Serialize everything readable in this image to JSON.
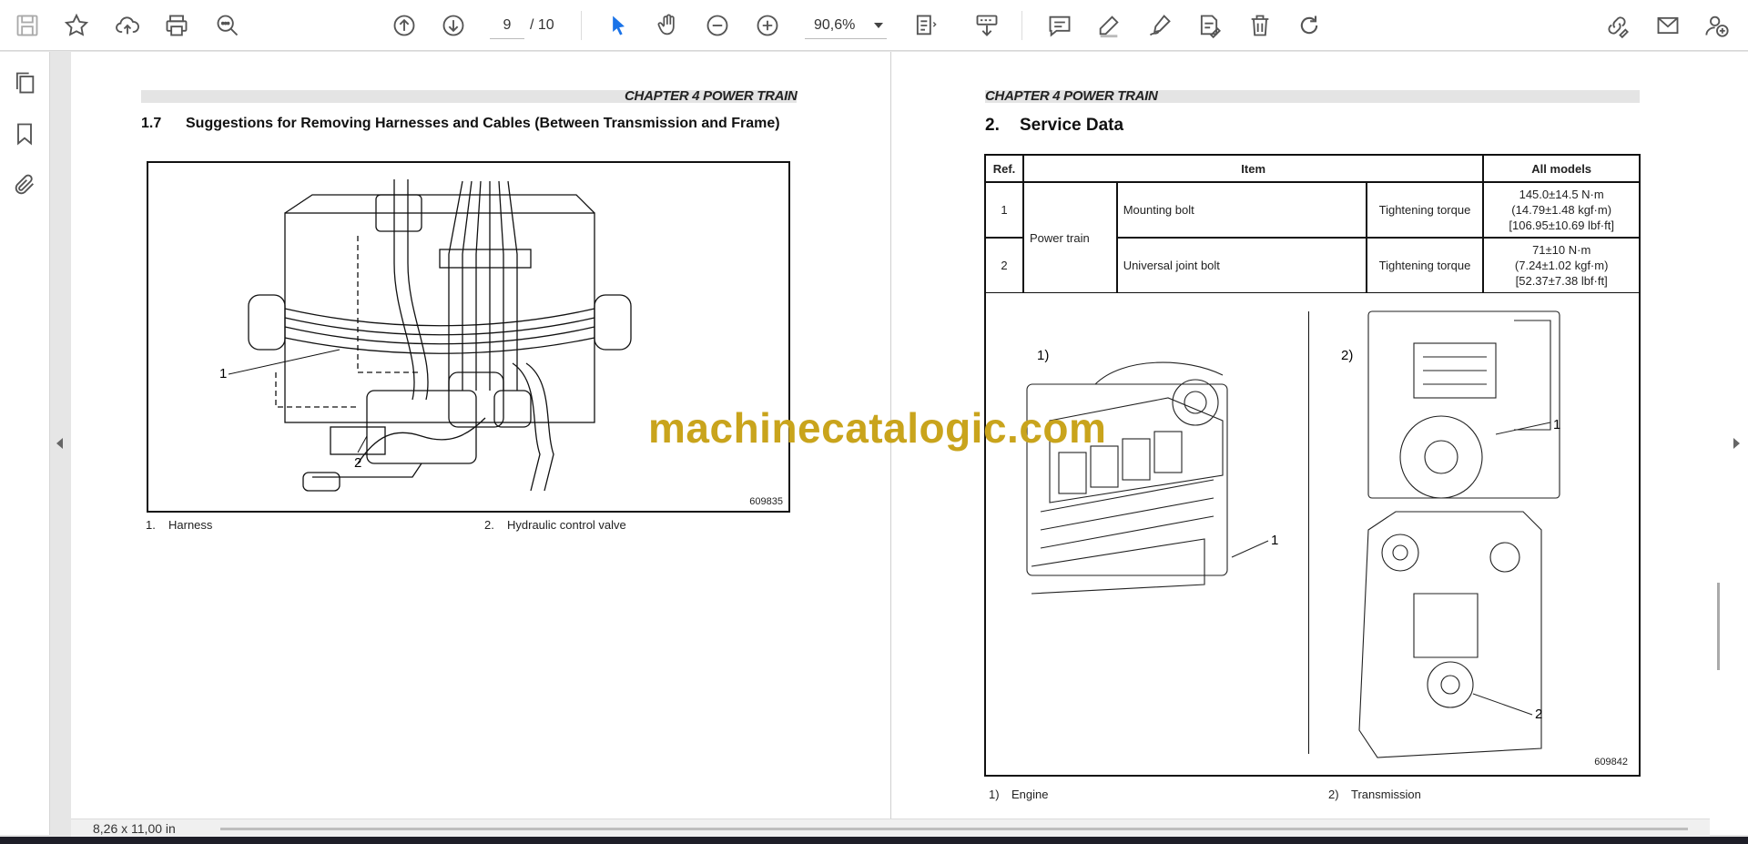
{
  "toolbar": {
    "page_current": "9",
    "page_total": "/ 10",
    "zoom": "90,6%"
  },
  "left_page": {
    "chapter": "CHAPTER 4 POWER TRAIN",
    "section_number": "1.7",
    "section_title": "Suggestions for Removing Harnesses and Cables (Between Transmission and Frame)",
    "figure_code": "609835",
    "callout_1": "1",
    "callout_2": "2",
    "legend": [
      {
        "num": "1.",
        "text": "Harness"
      },
      {
        "num": "2.",
        "text": "Hydraulic control valve"
      }
    ]
  },
  "right_page": {
    "chapter": "CHAPTER 4 POWER TRAIN",
    "section_number": "2.",
    "section_title": "Service Data",
    "table": {
      "headers": [
        "Ref.",
        "Item",
        "All models"
      ],
      "group": "Power train",
      "rows": [
        {
          "ref": "1",
          "item": "Mounting bolt",
          "type": "Tightening torque",
          "val1": "145.0±14.5 N·m",
          "val2": "(14.79±1.48 kgf·m)",
          "val3": "[106.95±10.69 lbf·ft]"
        },
        {
          "ref": "2",
          "item": "Universal joint bolt",
          "type": "Tightening torque",
          "val1": "71±10 N·m",
          "val2": "(7.24±1.02 kgf·m)",
          "val3": "[52.37±7.38 lbf·ft]"
        }
      ]
    },
    "figure_code": "609842",
    "panel1_label": "1)",
    "panel2_label": "2)",
    "engine_callout": "1",
    "trans_callout_1": "1",
    "trans_callout_2": "2",
    "legend": [
      {
        "num": "1)",
        "text": "Engine"
      },
      {
        "num": "2)",
        "text": "Transmission"
      }
    ]
  },
  "watermark": "machinecatalogic.com",
  "status": {
    "page_size": "8,26 x 11,00 in"
  }
}
